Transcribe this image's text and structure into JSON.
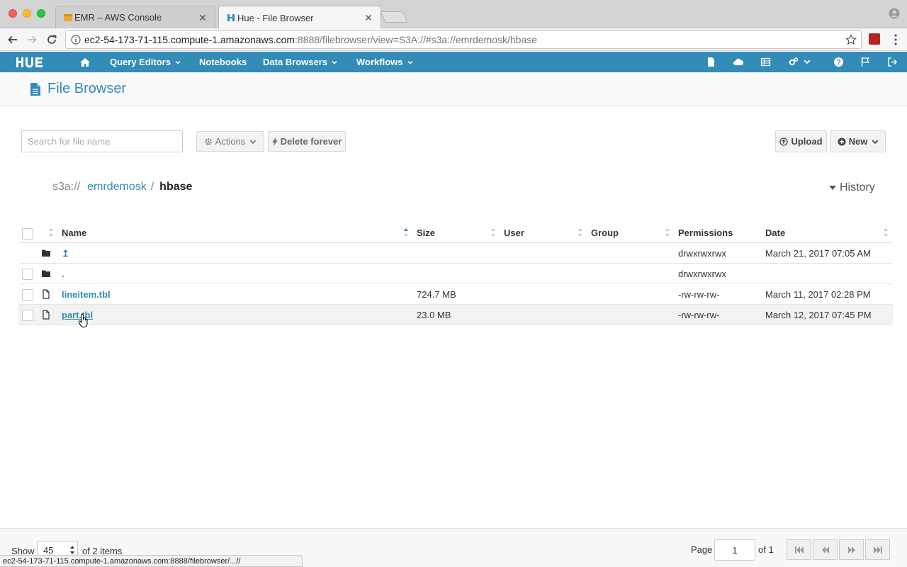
{
  "browser": {
    "tabs": [
      {
        "title": "EMR – AWS Console",
        "active": false,
        "icon": "aws-cube-icon"
      },
      {
        "title": "Hue - File Browser",
        "active": true,
        "icon": "hue-favicon-icon"
      }
    ],
    "url_host": "ec2-54-173-71-115.compute-1.amazonaws.com",
    "url_rest": ":8888/filebrowser/view=S3A://#s3a://emrdemosk/hbase",
    "status_url": "ec2-54-173-71-115.compute-1.amazonaws.com:8888/filebrowser/...//"
  },
  "hue_nav": {
    "logo": "HUE",
    "items": [
      {
        "label": "Query Editors",
        "dropdown": true
      },
      {
        "label": "Notebooks",
        "dropdown": false
      },
      {
        "label": "Data Browsers",
        "dropdown": true
      },
      {
        "label": "Workflows",
        "dropdown": true
      }
    ],
    "accent": "#338bb8"
  },
  "page": {
    "title": "File Browser"
  },
  "actions": {
    "search_placeholder": "Search for file name",
    "actions_label": "Actions",
    "delete_label": "Delete forever",
    "upload_label": "Upload",
    "new_label": "New"
  },
  "breadcrumb": {
    "root": "s3a://",
    "bucket": "emrdemosk",
    "separator": "/",
    "current": "hbase"
  },
  "history_label": "History",
  "table": {
    "columns": [
      "Name",
      "Size",
      "User",
      "Group",
      "Permissions",
      "Date"
    ],
    "rows": [
      {
        "type": "folder",
        "name": "↥",
        "size": "",
        "user": "",
        "group": "",
        "permissions": "drwxrwxrwx",
        "date": "March 21, 2017 07:05 AM"
      },
      {
        "type": "folder",
        "name": ".",
        "size": "",
        "user": "",
        "group": "",
        "permissions": "drwxrwxrwx",
        "date": ""
      },
      {
        "type": "file",
        "name": "lineitem.tbl",
        "size": "724.7 MB",
        "user": "",
        "group": "",
        "permissions": "-rw-rw-rw-",
        "date": "March 11, 2017 02:28 PM"
      },
      {
        "type": "file",
        "name": "part.tbl",
        "size": "23.0 MB",
        "user": "",
        "group": "",
        "permissions": "-rw-rw-rw-",
        "date": "March 12, 2017 07:45 PM"
      }
    ]
  },
  "footer": {
    "show_label": "Show",
    "page_size": "45",
    "items_text": "of 2 items",
    "page_label": "Page",
    "page_value": "1",
    "page_of": "of 1"
  }
}
